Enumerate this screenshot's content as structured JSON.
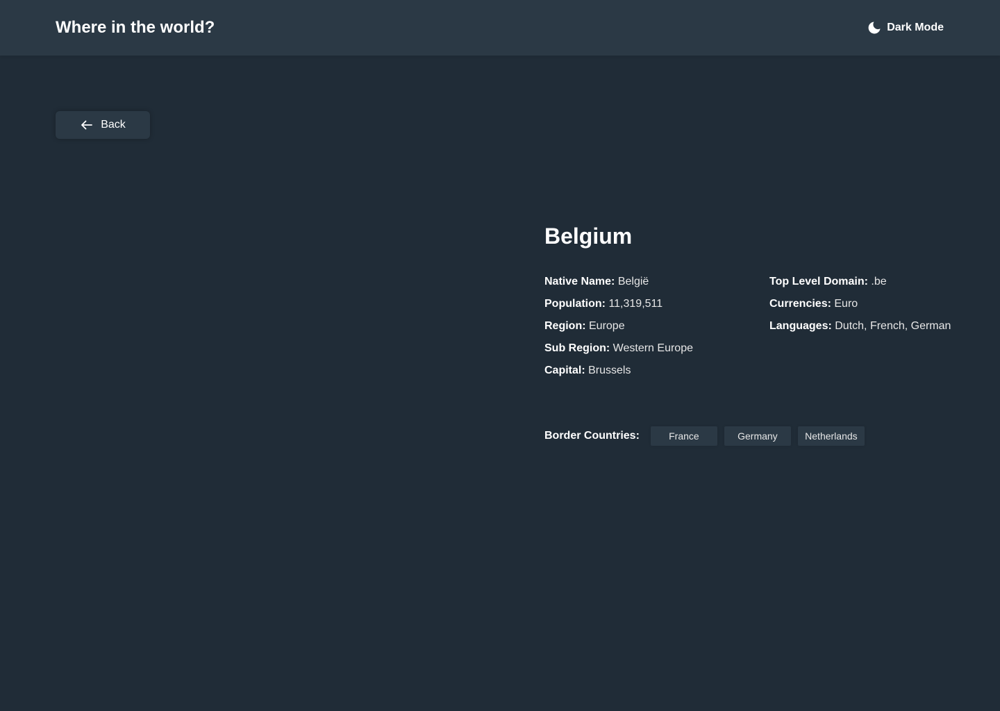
{
  "header": {
    "title": "Where in the world?",
    "mode_toggle": {
      "icon": "moon-icon",
      "label": "Dark Mode"
    }
  },
  "back_button": {
    "icon": "arrow-left-icon",
    "label": "Back"
  },
  "country": {
    "name": "Belgium",
    "details_left": [
      {
        "label": "Native Name:",
        "value": "België"
      },
      {
        "label": "Population:",
        "value": "11,319,511"
      },
      {
        "label": "Region:",
        "value": "Europe"
      },
      {
        "label": "Sub Region:",
        "value": "Western Europe"
      },
      {
        "label": "Capital:",
        "value": "Brussels"
      }
    ],
    "details_right": [
      {
        "label": "Top Level Domain:",
        "value": ".be"
      },
      {
        "label": "Currencies:",
        "value": "Euro"
      },
      {
        "label": "Languages:",
        "value": "Dutch, French, German"
      }
    ],
    "borders_label": "Border Countries:",
    "borders": [
      "France",
      "Germany",
      "Netherlands"
    ]
  },
  "colors": {
    "background": "#202c37",
    "element": "#2b3945",
    "text": "#ffffff"
  }
}
